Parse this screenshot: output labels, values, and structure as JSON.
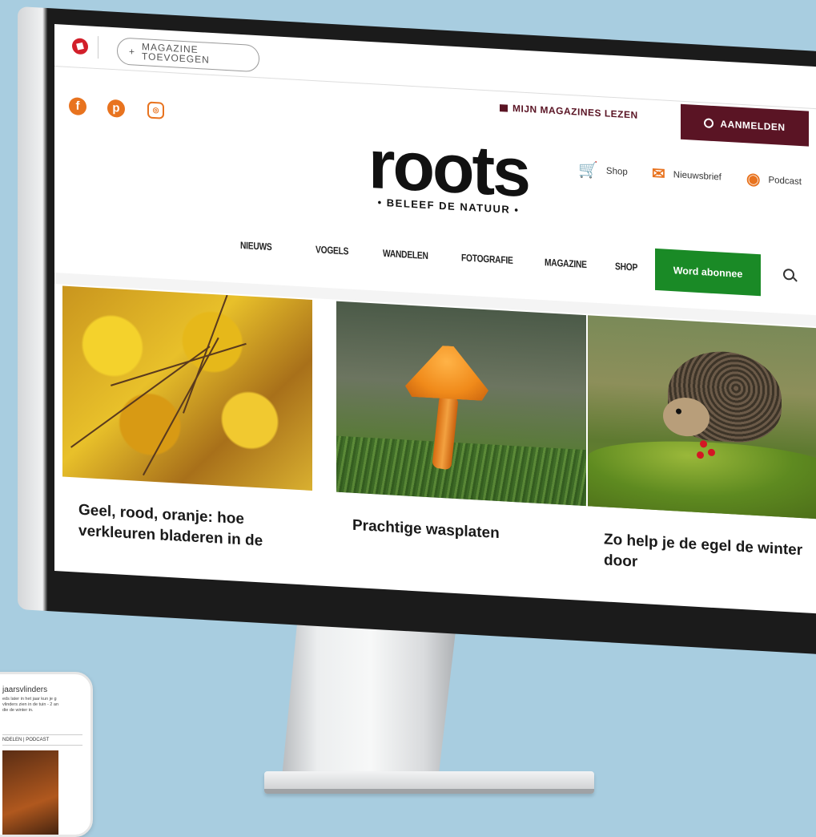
{
  "phone": {
    "title": "jaarsvlinders",
    "body": "eds later in het jaar kun je g vlinders zien in de tuin - 2 an die de winter in.",
    "nav": "NDELEN   |   PODCAST"
  },
  "topbar": {
    "add_magazine": "MAGAZINE TOEVOEGEN",
    "plus": "+",
    "my_magazines": "MIJN MAGAZINES LEZEN",
    "login": "AANMELDEN"
  },
  "social": {
    "facebook": "f",
    "pinterest": "p",
    "instagram": "◎"
  },
  "brand": {
    "name": "roots",
    "tagline": "• BELEEF DE NATUUR •"
  },
  "utility": [
    {
      "label": "Shop",
      "icon": "cart-icon"
    },
    {
      "label": "Nieuwsbrief",
      "icon": "mail-icon"
    },
    {
      "label": "Podcast",
      "icon": "podcast-icon"
    }
  ],
  "nav": {
    "items": [
      "NIEUWS",
      "VOGELS",
      "WANDELEN",
      "FOTOGRAFIE",
      "MAGAZINE",
      "SHOP"
    ],
    "cta": "Word abonnee"
  },
  "cards": [
    {
      "title": "Geel, rood, oranje: hoe verkleuren bladeren in de",
      "image": "autumn-leaves"
    },
    {
      "title": "Prachtige wasplaten",
      "image": "orange-mushroom"
    },
    {
      "title": "Zo help je de egel de winter door",
      "image": "hedgehog"
    }
  ],
  "colors": {
    "accent": "#e8731f",
    "brand_dark": "#5a1424",
    "cta_green": "#1a8a26",
    "background": "#a8cde0"
  }
}
